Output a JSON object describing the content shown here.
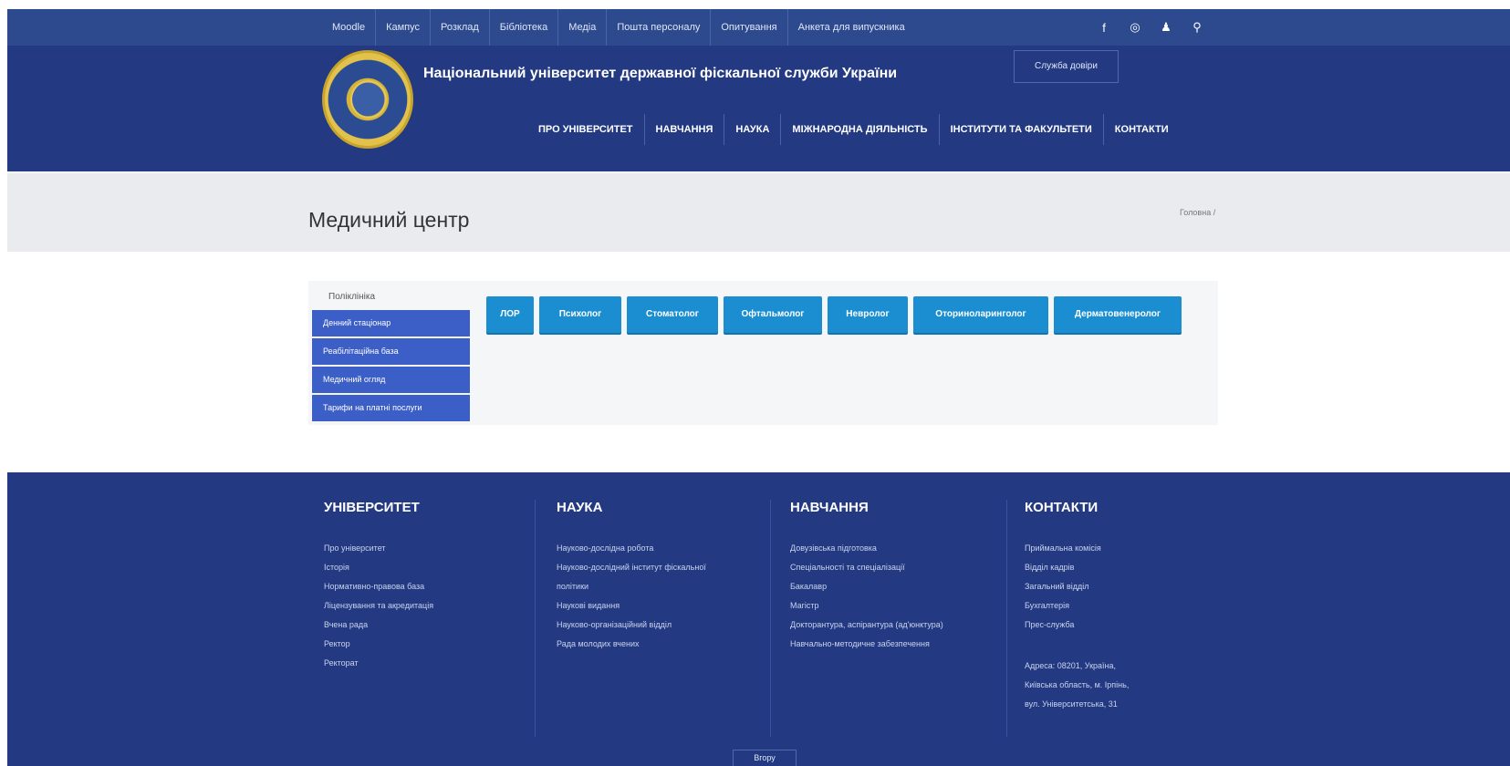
{
  "topbar": {
    "links": [
      "Moodle",
      "Кампус",
      "Розклад",
      "Бібліотека",
      "Медіа",
      "Пошта персоналу",
      "Опитування",
      "Анкета для випускника"
    ],
    "icons": [
      "facebook-icon",
      "instagram-icon",
      "user-icon",
      "search-icon"
    ],
    "icon_glyphs": [
      "f",
      "◎",
      "♟",
      "⚲"
    ]
  },
  "header": {
    "title": "Національний університет державної фіскальної служби України",
    "trust_button": "Служба довіри",
    "nav": [
      "ПРО УНІВЕРСИТЕТ",
      "НАВЧАННЯ",
      "НАУКА",
      "МІЖНАРОДНА ДІЯЛЬНІСТЬ",
      "ІНСТИТУТИ ТА ФАКУЛЬТЕТИ",
      "КОНТАКТИ"
    ]
  },
  "titleband": {
    "title": "Медичний центр",
    "breadcrumb": "Головна /"
  },
  "content": {
    "sidebar_heading": "Поліклініка",
    "sidebar_items": [
      "Денний стаціонар",
      "Реабілітаційна база",
      "Медичний огляд",
      "Тарифи на платні послуги"
    ],
    "tabs": [
      "ЛОР",
      "Психолог",
      "Стоматолог",
      "Офтальмолог",
      "Невролог",
      "Оториноларинголог",
      "Дерматовенеролог"
    ]
  },
  "footer": {
    "columns": [
      {
        "title": "УНІВЕРСИТЕТ",
        "links": [
          "Про університет",
          "Історія",
          "Нормативно-правова база",
          "Ліцензування та акредитація",
          "Вчена рада",
          "Ректор",
          "Ректорат"
        ]
      },
      {
        "title": "НАУКА",
        "links": [
          "Науково-дослідна робота",
          "Науково-дослідний інститут фіскальної",
          "політики",
          "Наукові видання",
          "Науково-організаційний відділ",
          "Рада молодих вчених"
        ]
      },
      {
        "title": "НАВЧАННЯ",
        "links": [
          "Довузівська підготовка",
          "Спеціальності та спеціалізації",
          "Бакалавр",
          "Магістр",
          "Докторантура, аспірантура (ад'юнктура)",
          "Навчально-методичне забезпечення"
        ]
      },
      {
        "title": "КОНТАКТИ",
        "links": [
          "Приймальна комісія",
          "Відділ кадрів",
          "Загальний відділ",
          "Бухгалтерія",
          "Прес-служба"
        ]
      }
    ],
    "address": [
      "Адреса: 08201, Україна,",
      "Київська область, м. Ірпінь,",
      "вул. Університетська, 31"
    ],
    "scroll_top": "Вгору"
  }
}
